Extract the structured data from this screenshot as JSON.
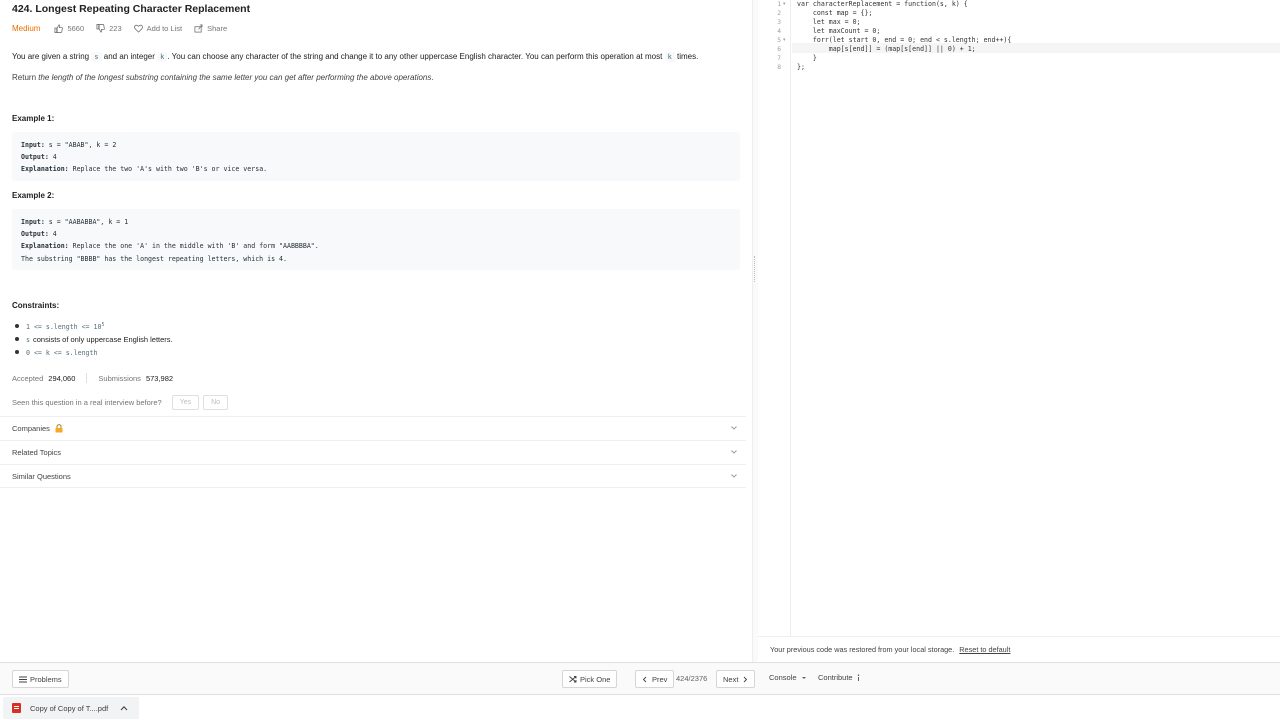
{
  "problem": {
    "title": "424. Longest Repeating Character Replacement",
    "difficulty": "Medium",
    "likes": "5660",
    "dislikes": "223",
    "add_to_list": "Add to List",
    "share": "Share",
    "desc_p1_a": "You are given a string ",
    "desc_p1_s": "s",
    "desc_p1_b": " and an integer ",
    "desc_p1_k": "k",
    "desc_p1_c": ". You can choose any character of the string and change it to any other uppercase English character. You can perform this operation at most ",
    "desc_p1_k2": "k",
    "desc_p1_d": " times.",
    "desc_p2_a": "Return ",
    "desc_p2_em": "the length of the longest substring containing the same letter you can get after performing the above operations",
    "desc_p2_b": "."
  },
  "examples": [
    {
      "title": "Example 1:",
      "input_label": "Input:",
      "input": " s = \"ABAB\", k = 2",
      "output_label": "Output:",
      "output": " 4",
      "explanation_label": "Explanation:",
      "explanation": " Replace the two 'A's with two 'B's or vice versa."
    },
    {
      "title": "Example 2:",
      "input_label": "Input:",
      "input": " s = \"AABABBA\", k = 1",
      "output_label": "Output:",
      "output": " 4",
      "explanation_label": "Explanation:",
      "explanation": " Replace the one 'A' in the middle with 'B' and form \"AABBBBA\".",
      "explanation_2": "The substring \"BBBB\" has the longest repeating letters, which is 4."
    }
  ],
  "constraints": {
    "title": "Constraints:",
    "c1_a": "1 <= s.length <= 10",
    "c1_sup": "5",
    "c2_code": "s",
    "c2_text": " consists of only uppercase English letters.",
    "c3": "0 <= k <= s.length"
  },
  "stats": {
    "accepted_label": "Accepted",
    "accepted": "294,060",
    "submissions_label": "Submissions",
    "submissions": "573,982"
  },
  "interview": {
    "question": "Seen this question in a real interview before?",
    "yes": "Yes",
    "no": "No"
  },
  "sections": {
    "companies": "Companies",
    "related_topics": "Related Topics",
    "similar_questions": "Similar Questions"
  },
  "editor": {
    "line_numbers": [
      "1",
      "2",
      "3",
      "4",
      "5",
      "6",
      "7",
      "8"
    ],
    "lines": [
      "var characterReplacement = function(s, k) {",
      "    const map = {};",
      "    let max = 0;",
      "    let maxCount = 0;",
      "    forr(let start 0, end = 0; end < s.length; end++){",
      "        map[s[end]] = (map[s[end]] || 0) + 1;",
      "    }",
      "};"
    ],
    "restore_msg": "Your previous code was restored from your local storage.",
    "reset_link": "Reset to default"
  },
  "bottom": {
    "problems": "Problems",
    "pick_one": "Pick One",
    "prev": "Prev",
    "page": "424/2376",
    "next": "Next",
    "console": "Console",
    "contribute": "Contribute"
  },
  "download": {
    "filename": "Copy of Copy of T....pdf"
  }
}
